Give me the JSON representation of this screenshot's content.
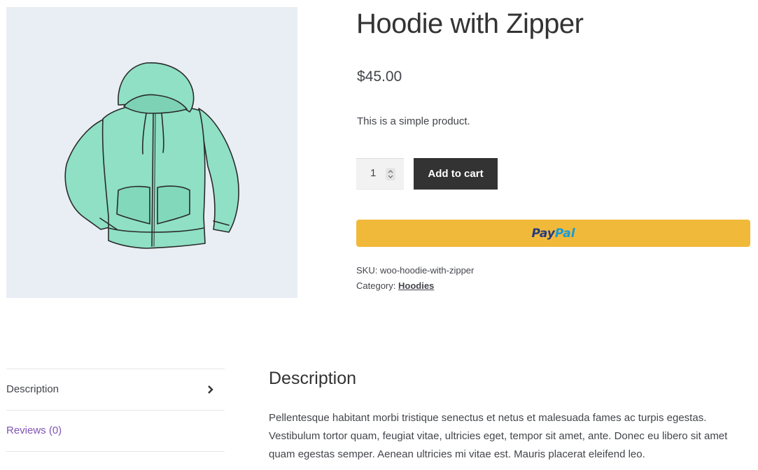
{
  "product": {
    "title": "Hoodie with Zipper",
    "price": "$45.00",
    "short_description": "This is a simple product.",
    "image_alt": "mint hoodie with zipper illustration",
    "image_colors": {
      "background": "#e8eef3",
      "garment": "#8fe0c4",
      "outline": "#2a2a2a"
    }
  },
  "cart": {
    "quantity": "1",
    "add_to_cart_label": "Add to cart",
    "paypal_brand_part1": "Pay",
    "paypal_brand_part2": "Pal",
    "paypal_button_color": "#f1b93a"
  },
  "meta": {
    "sku_label": "SKU:",
    "sku_value": "woo-hoodie-with-zipper",
    "category_label": "Category:",
    "category_value": "Hoodies"
  },
  "tabs": [
    {
      "label": "Description",
      "active": true
    },
    {
      "label": "Reviews (0)",
      "active": false
    }
  ],
  "description": {
    "heading": "Description",
    "text": "Pellentesque habitant morbi tristique senectus et netus et malesuada fames ac turpis egestas. Vestibulum tortor quam, feugiat vitae, ultricies eget, tempor sit amet, ante. Donec eu libero sit amet quam egestas semper. Aenean ultricies mi vitae est. Mauris placerat eleifend leo."
  },
  "colors": {
    "accent_link": "#7f54b3",
    "button_dark": "#333333",
    "text": "#43454b"
  }
}
